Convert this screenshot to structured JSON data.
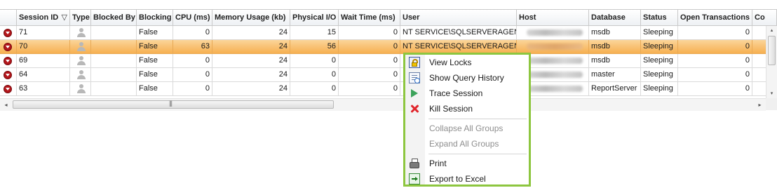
{
  "grid": {
    "columns": [
      {
        "key": "icon",
        "label": ""
      },
      {
        "key": "session_id",
        "label": "Session ID",
        "sort_icon": "▽"
      },
      {
        "key": "type",
        "label": "Type"
      },
      {
        "key": "blocked_by",
        "label": "Blocked By"
      },
      {
        "key": "blocking",
        "label": "Blocking"
      },
      {
        "key": "cpu",
        "label": "CPU (ms)"
      },
      {
        "key": "memory",
        "label": "Memory Usage (kb)"
      },
      {
        "key": "physical_io",
        "label": "Physical I/O"
      },
      {
        "key": "wait_time",
        "label": "Wait Time (ms)"
      },
      {
        "key": "user",
        "label": "User"
      },
      {
        "key": "host",
        "label": "Host"
      },
      {
        "key": "database",
        "label": "Database"
      },
      {
        "key": "status",
        "label": "Status"
      },
      {
        "key": "open_transactions",
        "label": "Open Transactions"
      },
      {
        "key": "more",
        "label": "Co"
      }
    ],
    "rows": [
      {
        "session_id": "71",
        "blocked_by": "",
        "blocking": "False",
        "cpu": "0",
        "memory": "24",
        "physical_io": "15",
        "wait_time": "0",
        "user": "NT SERVICE\\SQLSERVERAGENT",
        "database": "msdb",
        "status": "Sleeping",
        "open_transactions": "0",
        "selected": false
      },
      {
        "session_id": "70",
        "blocked_by": "",
        "blocking": "False",
        "cpu": "63",
        "memory": "24",
        "physical_io": "56",
        "wait_time": "0",
        "user": "NT SERVICE\\SQLSERVERAGENT",
        "database": "msdb",
        "status": "Sleeping",
        "open_transactions": "0",
        "selected": true
      },
      {
        "session_id": "69",
        "blocked_by": "",
        "blocking": "False",
        "cpu": "0",
        "memory": "24",
        "physical_io": "0",
        "wait_time": "0",
        "user": "",
        "database": "msdb",
        "status": "Sleeping",
        "open_transactions": "0",
        "selected": false
      },
      {
        "session_id": "64",
        "blocked_by": "",
        "blocking": "False",
        "cpu": "0",
        "memory": "24",
        "physical_io": "0",
        "wait_time": "0",
        "user": "",
        "database": "master",
        "status": "Sleeping",
        "open_transactions": "0",
        "selected": false
      },
      {
        "session_id": "63",
        "blocked_by": "",
        "blocking": "False",
        "cpu": "0",
        "memory": "24",
        "physical_io": "0",
        "wait_time": "0",
        "user": "",
        "database": "ReportServer",
        "status": "Sleeping",
        "open_transactions": "0",
        "selected": false
      }
    ],
    "row_icon": "session-down-icon",
    "type_icon": "user-icon",
    "colors": {
      "selected_row": "#f6ae4d",
      "menu_border": "#8dc63f",
      "row_icon": "#b3161b"
    }
  },
  "scrollbars": {
    "left_arrow": "◂",
    "right_arrow": "▸",
    "up_arrow": "▴",
    "down_arrow": "▾",
    "grip": "|||"
  },
  "context_menu": {
    "items": [
      {
        "label": "View Locks",
        "icon": "view-locks-icon",
        "enabled": true
      },
      {
        "label": "Show Query History",
        "icon": "query-history-icon",
        "enabled": true
      },
      {
        "label": "Trace Session",
        "icon": "trace-play-icon",
        "enabled": true
      },
      {
        "label": "Kill Session",
        "icon": "kill-x-icon",
        "enabled": true
      },
      {
        "label": "Collapse All Groups",
        "icon": "",
        "enabled": false
      },
      {
        "label": "Expand All Groups",
        "icon": "",
        "enabled": false
      },
      {
        "label": "Print",
        "icon": "printer-icon",
        "enabled": true
      },
      {
        "label": "Export to Excel",
        "icon": "export-excel-icon",
        "enabled": true
      }
    ]
  }
}
